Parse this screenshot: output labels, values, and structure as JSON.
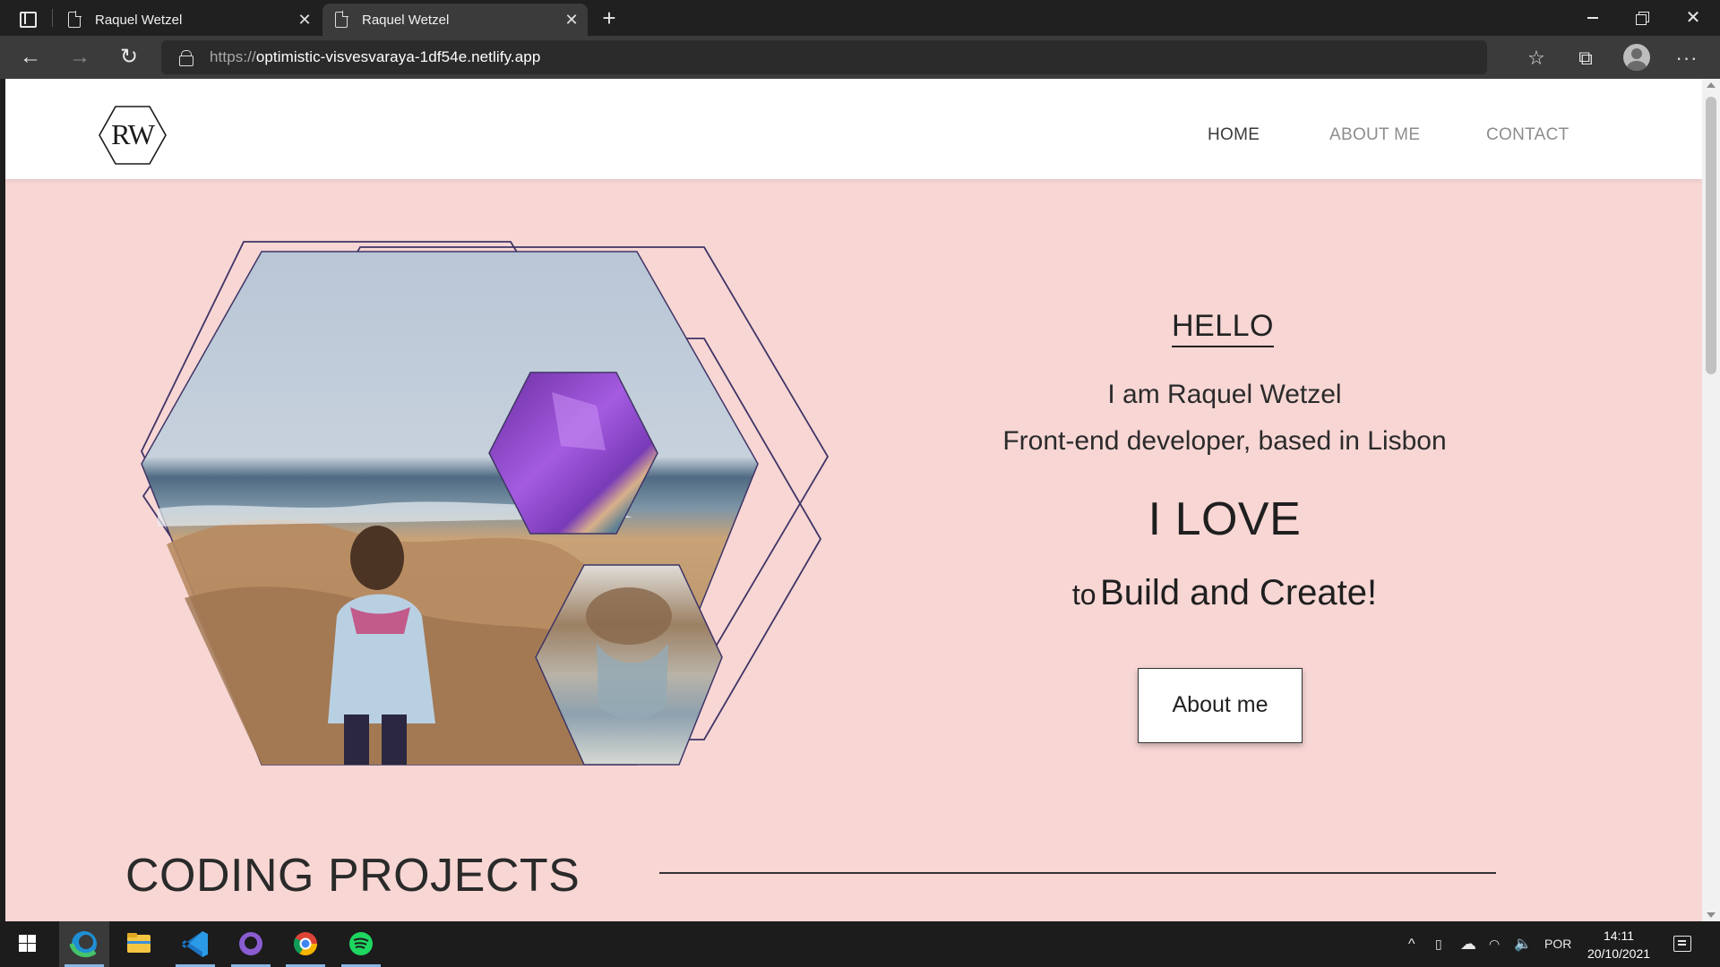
{
  "browser": {
    "tabs": [
      {
        "title": "Raquel Wetzel",
        "active": false
      },
      {
        "title": "Raquel Wetzel",
        "active": true
      }
    ],
    "url_protocol": "https://",
    "url_host": "optimistic-visvesvaraya-1df54e.netlify.app",
    "icons": {
      "tab_actions": "tab-actions-icon",
      "new_tab": "plus-icon",
      "back": "arrow-left-icon",
      "forward": "arrow-right-icon",
      "reload": "reload-icon",
      "site_info": "lock-icon",
      "add_favorite": "star-plus-icon",
      "favorites": "favorites-list-icon",
      "collections": "collections-icon",
      "profile": "profile-avatar-icon",
      "more": "more-dots-icon"
    }
  },
  "site": {
    "logo_text": "RW",
    "nav": [
      {
        "label": "HOME",
        "active": true
      },
      {
        "label": "ABOUT ME",
        "active": false
      },
      {
        "label": "CONTACT",
        "active": false
      }
    ],
    "hero": {
      "hello": "HELLO",
      "line1": "I am Raquel Wetzel",
      "line2": "Front-end developer, based in Lisbon",
      "love": "I LOVE",
      "build_prefix": "to",
      "build_rest": "Build and Create!",
      "button": "About me"
    },
    "section_title": "CODING PROJECTS",
    "colors": {
      "page_background": "#f7d6d4",
      "hexagon_outline": "#3f3566",
      "text": "#222222"
    }
  },
  "taskbar": {
    "apps": [
      "windows-start-icon",
      "edge-icon",
      "file-explorer-icon",
      "vscode-icon",
      "github-desktop-icon",
      "chrome-icon",
      "spotify-icon"
    ],
    "language": "POR",
    "time": "14:11",
    "date": "20/10/2021"
  }
}
